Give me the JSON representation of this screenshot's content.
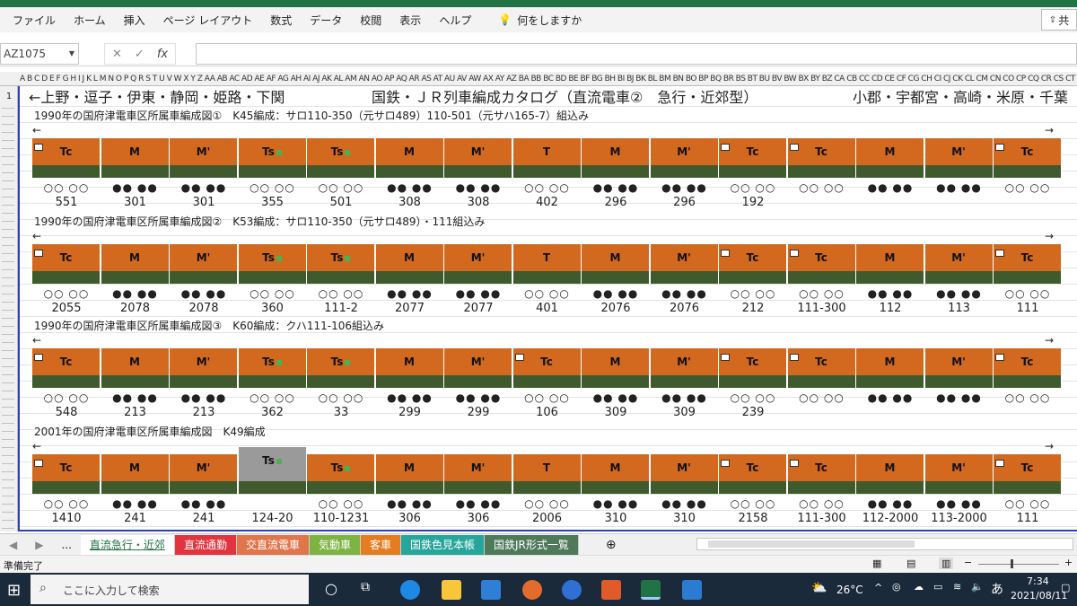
{
  "ribbon": {
    "menus": [
      "ファイル",
      "ホーム",
      "挿入",
      "ページ レイアウト",
      "数式",
      "データ",
      "校閲",
      "表示",
      "ヘルプ"
    ],
    "tell_me": "何をしますか",
    "share": "共"
  },
  "formula_bar": {
    "name_box": "AZ1075",
    "fx": "fx"
  },
  "column_header_text": "A B C D E F G H I J K L M N O P Q R S T U V W X Y Z AA AB AC AD AE AF AG AH AI AJ AK AL AM AN AO AP AQ AR AS AT AU AV AW AX AY AZ BA BB BC BD BE BF BG BH BI BJ BK BL BM BN BO BP BQ BR BS BT BU BV BW BX BY BZ CA CB CC CD CE CF CG CH CI CJ CK CL CM CN CO CP CQ CR CS CT CU CV CW CX CY CZ DA DB DC DD DE DF DG DH DI DJ DK DL DM DN DO",
  "row_first": "1",
  "sheet": {
    "title_left": "←上野・逗子・伊東・静岡・姫路・下関",
    "title_center": "国鉄・ＪＲ列車編成カタログ（直流電車②　急行・近郊型）",
    "title_right": "小郡・宇都宮・高崎・米原・千葉",
    "sections": [
      {
        "title": "1990年の国府津電車区所属車編成図①　K45編成：サロ110-350（元サロ489）110-501（元サハ165-7）組込み",
        "cars": [
          "Tc",
          "M",
          "M'",
          "Ts",
          "Ts",
          "M",
          "M'",
          "T",
          "M",
          "M'",
          "Tc",
          "Tc",
          "M",
          "M'",
          "Tc"
        ],
        "wheels": [
          "○○ ○○",
          "●● ●●",
          "●● ●●",
          "○○ ○○",
          "○○ ○○",
          "●● ●●",
          "●● ●●",
          "○○ ○○",
          "●● ●●",
          "●● ●●",
          "○○ ○○",
          "○○ ○○",
          "●● ●●",
          "●● ●●",
          "○○ ○○"
        ],
        "numbers": [
          "551",
          "301",
          "301",
          "355",
          "501",
          "308",
          "308",
          "402",
          "296",
          "296",
          "192",
          "",
          "",
          "",
          ""
        ]
      },
      {
        "title": "1990年の国府津電車区所属車編成図②　K53編成：サロ110-350（元サロ489）・111組込み",
        "cars": [
          "Tc",
          "M",
          "M'",
          "Ts",
          "Ts",
          "M",
          "M'",
          "T",
          "M",
          "M'",
          "Tc",
          "Tc",
          "M",
          "M'",
          "Tc"
        ],
        "wheels": [
          "○○ ○○",
          "●● ●●",
          "●● ●●",
          "○○ ○○",
          "○○ ○○",
          "●● ●●",
          "●● ●●",
          "○○ ○○",
          "●● ●●",
          "●● ●●",
          "○○ ○○",
          "○○ ○○",
          "●● ●●",
          "●● ●●",
          "○○ ○○"
        ],
        "numbers": [
          "2055",
          "2078",
          "2078",
          "360",
          "111-2",
          "2077",
          "2077",
          "401",
          "2076",
          "2076",
          "212",
          "111-300",
          "112",
          "113",
          "111"
        ]
      },
      {
        "title": "1990年の国府津電車区所属車編成図③　K60編成：クハ111-106組込み",
        "cars": [
          "Tc",
          "M",
          "M'",
          "Ts",
          "Ts",
          "M",
          "M'",
          "Tc",
          "M",
          "M'",
          "Tc",
          "Tc",
          "M",
          "M'",
          "Tc"
        ],
        "wheels": [
          "○○ ○○",
          "●● ●●",
          "●● ●●",
          "○○ ○○",
          "○○ ○○",
          "●● ●●",
          "●● ●●",
          "○○ ○○",
          "●● ●●",
          "●● ●●",
          "○○ ○○",
          "○○ ○○",
          "●● ●●",
          "●● ●●",
          "○○ ○○"
        ],
        "numbers": [
          "548",
          "213",
          "213",
          "362",
          "33",
          "299",
          "299",
          "106",
          "309",
          "309",
          "239",
          "",
          "",
          "",
          ""
        ]
      },
      {
        "title": "2001年の国府津電車区所属車編成図　K49編成",
        "cars": [
          "Tc",
          "M",
          "M'",
          "Ts",
          "Ts",
          "M",
          "M'",
          "T",
          "M",
          "M'",
          "Tc",
          "Tc",
          "M",
          "M'",
          "Tc"
        ],
        "wheels": [
          "○○ ○○",
          "●● ●●",
          "●● ●●",
          "",
          "○○ ○○",
          "●● ●●",
          "●● ●●",
          "○○ ○○",
          "●● ●●",
          "●● ●●",
          "○○ ○○",
          "○○ ○○",
          "●● ●●",
          "●● ●●",
          "○○ ○○"
        ],
        "numbers": [
          "1410",
          "241",
          "241",
          "124-20",
          "110-1231",
          "306",
          "306",
          "2006",
          "310",
          "310",
          "2158",
          "111-300",
          "112-2000",
          "113-2000",
          "111"
        ]
      }
    ]
  },
  "tabs": [
    "直流急行・近郊",
    "直流通勤",
    "交直流電車",
    "気動車",
    "客車",
    "国鉄色見本帳",
    "国鉄JR形式一覧"
  ],
  "tab_colors": [
    "#ffffff",
    "#e0343e",
    "#e0764c",
    "#7cb342",
    "#e57c20",
    "#26a69a",
    "#4e7a5a"
  ],
  "tab_nav_more": "...",
  "status": {
    "ready": "準備完了"
  },
  "taskbar": {
    "search": "ここに入力して検索",
    "temp": "26°C",
    "time": "7:34",
    "date": "2021/08/11",
    "ime": "あ"
  },
  "colors": {
    "car_orange": "#d2691e",
    "car_green": "#3f5b2e",
    "excel_green": "#217346"
  }
}
